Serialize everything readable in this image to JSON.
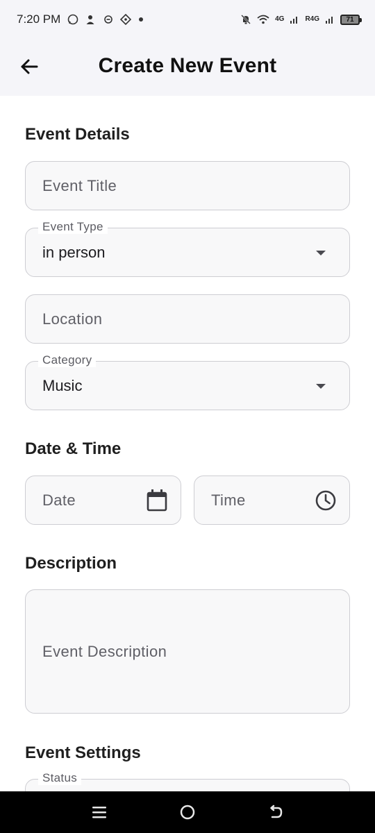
{
  "status_bar": {
    "time": "7:20 PM",
    "net_primary": "4G",
    "net_secondary": "R4G",
    "battery": "71"
  },
  "app_bar": {
    "title": "Create New Event"
  },
  "sections": {
    "event_details": "Event Details",
    "date_time": "Date & Time",
    "description": "Description",
    "event_settings": "Event Settings"
  },
  "fields": {
    "event_title": {
      "placeholder": "Event Title"
    },
    "event_type": {
      "label": "Event Type",
      "value": "in person"
    },
    "location": {
      "placeholder": "Location"
    },
    "category": {
      "label": "Category",
      "value": "Music"
    },
    "date": {
      "placeholder": "Date"
    },
    "time": {
      "placeholder": "Time"
    },
    "description": {
      "placeholder": "Event Description"
    },
    "status": {
      "label": "Status"
    }
  },
  "icons": {
    "back": "arrow-left-icon",
    "dropdown": "triangle-down-icon",
    "date": "calendar-icon",
    "time": "clock-icon"
  }
}
